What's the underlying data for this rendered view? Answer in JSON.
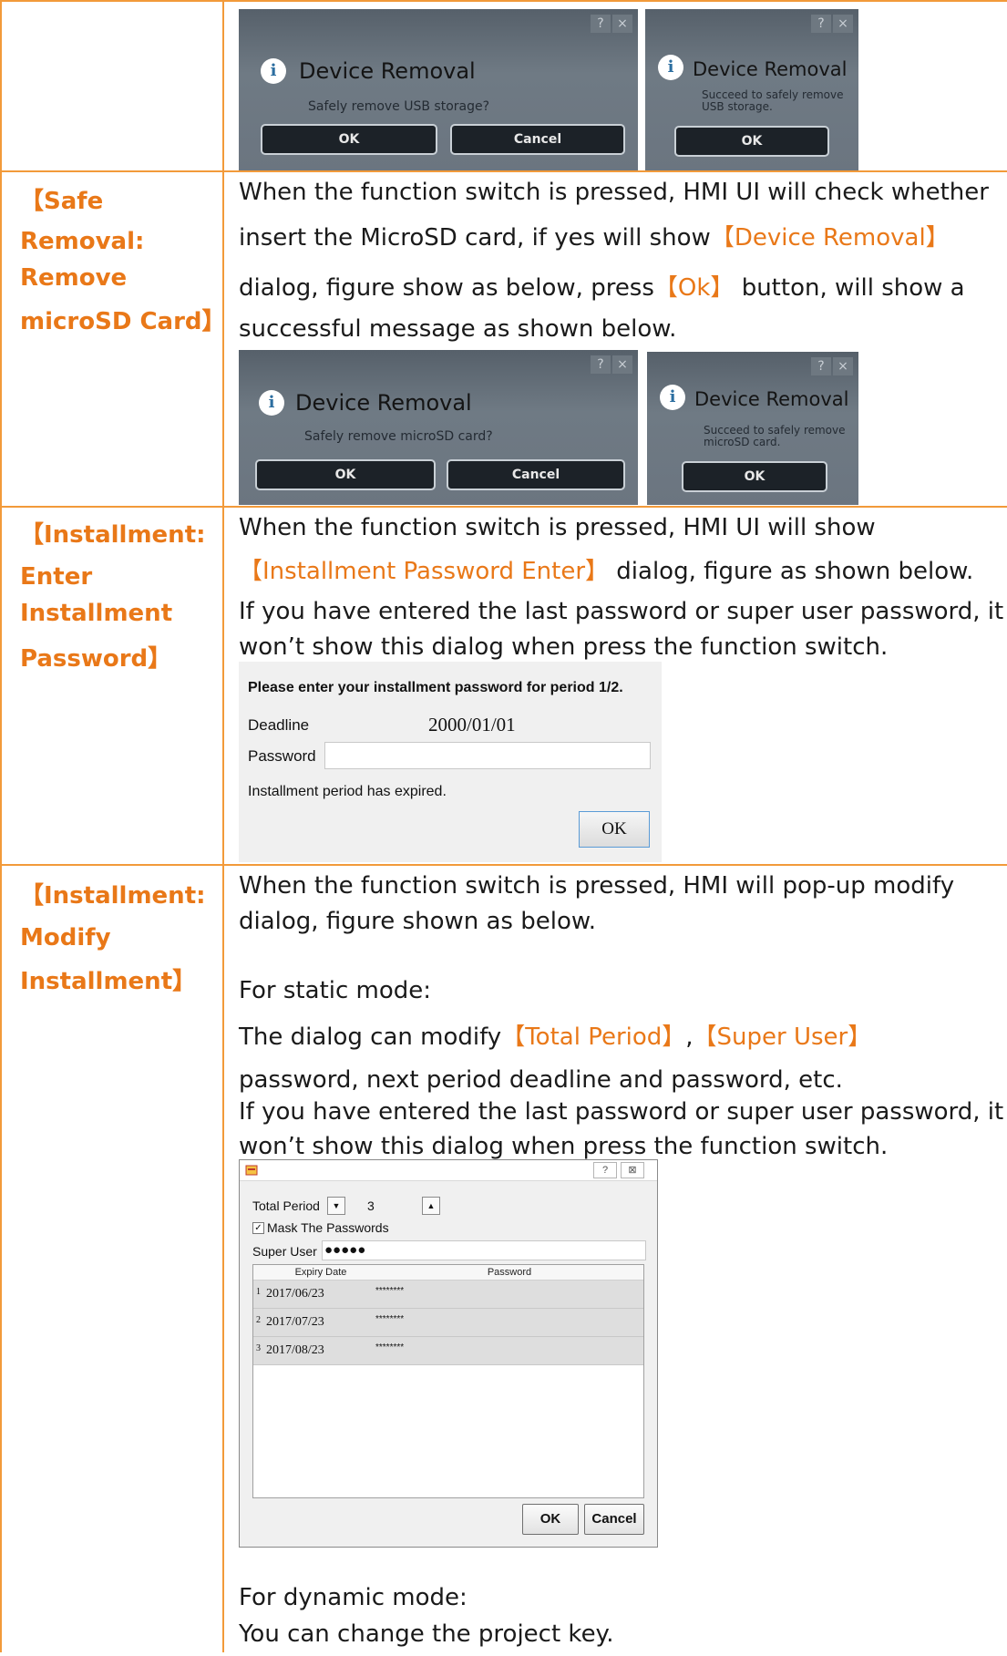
{
  "photo_dialogs": {
    "usb_confirm": {
      "title": "Device Removal",
      "message": "Safely remove USB storage?",
      "ok": "OK",
      "cancel": "Cancel",
      "help": "?",
      "close": "×"
    },
    "usb_success": {
      "title": "Device Removal",
      "message_line1": "Succeed to safely remove",
      "message_line2": "USB storage.",
      "ok": "OK",
      "help": "?",
      "close": "×"
    },
    "sd_confirm": {
      "title": "Device Removal",
      "message": "Safely remove microSD card?",
      "ok": "OK",
      "cancel": "Cancel",
      "help": "?",
      "close": "×"
    },
    "sd_success": {
      "title": "Device Removal",
      "message_line1": "Succeed to safely remove",
      "message_line2": "microSD card.",
      "ok": "OK",
      "help": "?",
      "close": "×"
    }
  },
  "rows": {
    "safe_removal_sd": {
      "label_lines": [
        "【Safe",
        "Removal:",
        "Remove",
        "microSD Card】"
      ],
      "line1": "When the function switch is pressed, HMI UI will check whether",
      "line2_pre": "insert the MicroSD card, if yes will show",
      "line2_hl": "【Device Removal】",
      "line3_pre": "dialog, figure show as below, press",
      "line3_hl": "【Ok】",
      "line3_post": " button, will show a",
      "line4": "successful message as shown below."
    },
    "installment_enter": {
      "label_lines": [
        "【Installment:",
        "Enter",
        "Installment",
        "Password】"
      ],
      "line1": "When the function switch is pressed, HMI UI will show",
      "line2_hl": "【Installment Password Enter】",
      "line2_post": " dialog, figure as shown below.",
      "line3": "If you have entered the last password or super user password, it",
      "line4": "won’t show this dialog when press the function switch."
    },
    "installment_modify": {
      "label_lines": [
        "【Installment:",
        "Modify",
        "Installment】"
      ],
      "line1": "When the function switch is pressed, HMI will pop-up modify",
      "line2": "dialog, figure shown as below.",
      "line3": "For static mode:",
      "line4_pre": "The dialog can modify",
      "line4_hl1": "【Total Period】",
      "line4_mid": ",",
      "line4_hl2": "【Super User】",
      "line5": "password, next period deadline and password, etc.",
      "line6": "If you have entered the last password or super user password, it",
      "line7": "won’t show this dialog when press the function switch.",
      "line8": "For dynamic mode:",
      "line9": "You can change the project key."
    }
  },
  "password_dialog": {
    "heading": "Please enter your installment password for period 1/2.",
    "deadline_label": "Deadline",
    "deadline_value": "2000/01/01",
    "password_label": "Password",
    "password_value": "",
    "status": "Installment period has expired.",
    "ok": "OK"
  },
  "modify_dialog": {
    "help": "?",
    "close": "⊠",
    "total_period_label": "Total Period",
    "total_period_value": "3",
    "mask_label": "Mask The Passwords",
    "mask_checked": true,
    "super_user_label": "Super User",
    "super_user_value": "●●●●●",
    "col_expiry": "Expiry Date",
    "col_password": "Password",
    "rows": [
      {
        "index": "1",
        "date": "2017/06/23",
        "password": "********"
      },
      {
        "index": "2",
        "date": "2017/07/23",
        "password": "********"
      },
      {
        "index": "3",
        "date": "2017/08/23",
        "password": "********"
      }
    ],
    "ok": "OK",
    "cancel": "Cancel"
  },
  "colors": {
    "accent": "#e97818",
    "border": "#f29a3a"
  }
}
